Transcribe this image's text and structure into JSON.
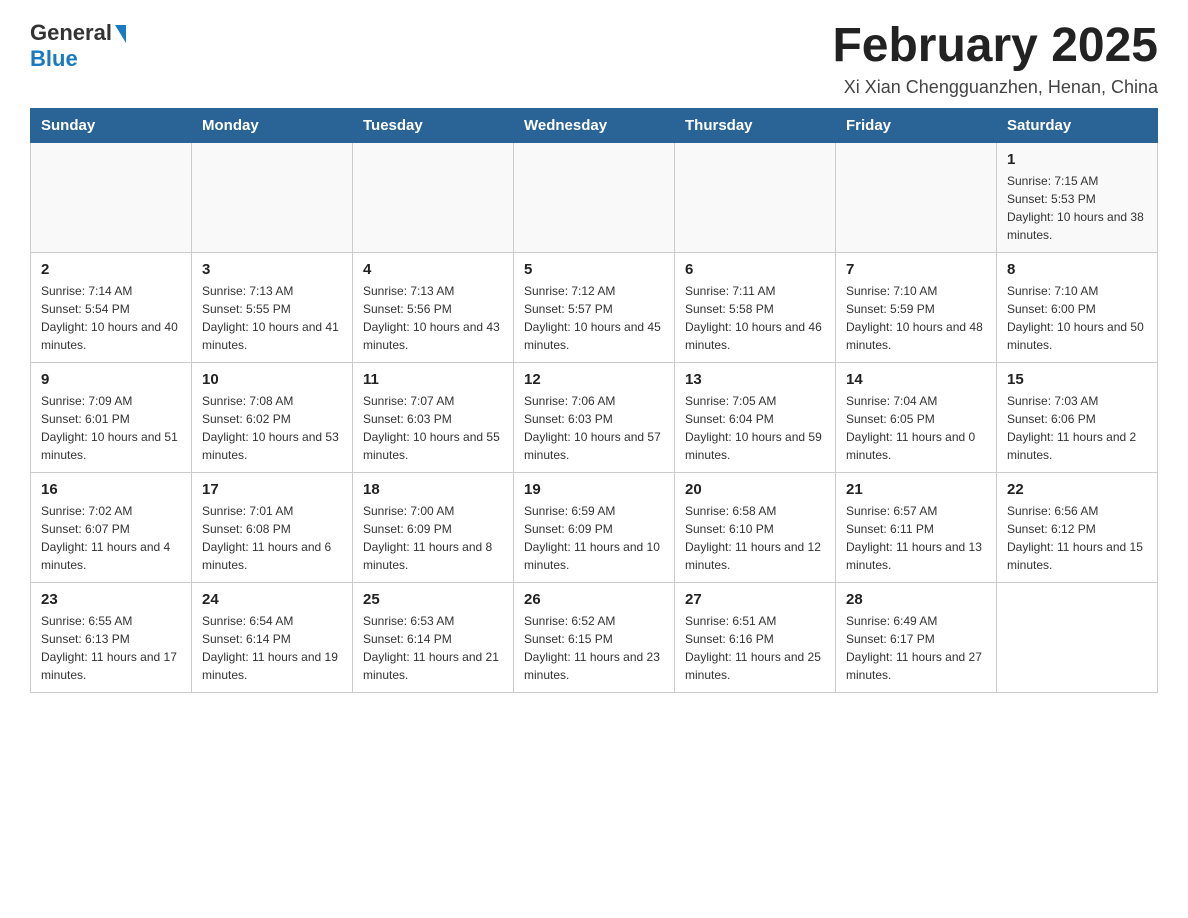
{
  "header": {
    "logo_general": "General",
    "logo_blue": "Blue",
    "month_title": "February 2025",
    "location": "Xi Xian Chengguanzhen, Henan, China"
  },
  "days_of_week": [
    "Sunday",
    "Monday",
    "Tuesday",
    "Wednesday",
    "Thursday",
    "Friday",
    "Saturday"
  ],
  "weeks": [
    {
      "days": [
        {
          "number": "",
          "info": ""
        },
        {
          "number": "",
          "info": ""
        },
        {
          "number": "",
          "info": ""
        },
        {
          "number": "",
          "info": ""
        },
        {
          "number": "",
          "info": ""
        },
        {
          "number": "",
          "info": ""
        },
        {
          "number": "1",
          "info": "Sunrise: 7:15 AM\nSunset: 5:53 PM\nDaylight: 10 hours and 38 minutes."
        }
      ]
    },
    {
      "days": [
        {
          "number": "2",
          "info": "Sunrise: 7:14 AM\nSunset: 5:54 PM\nDaylight: 10 hours and 40 minutes."
        },
        {
          "number": "3",
          "info": "Sunrise: 7:13 AM\nSunset: 5:55 PM\nDaylight: 10 hours and 41 minutes."
        },
        {
          "number": "4",
          "info": "Sunrise: 7:13 AM\nSunset: 5:56 PM\nDaylight: 10 hours and 43 minutes."
        },
        {
          "number": "5",
          "info": "Sunrise: 7:12 AM\nSunset: 5:57 PM\nDaylight: 10 hours and 45 minutes."
        },
        {
          "number": "6",
          "info": "Sunrise: 7:11 AM\nSunset: 5:58 PM\nDaylight: 10 hours and 46 minutes."
        },
        {
          "number": "7",
          "info": "Sunrise: 7:10 AM\nSunset: 5:59 PM\nDaylight: 10 hours and 48 minutes."
        },
        {
          "number": "8",
          "info": "Sunrise: 7:10 AM\nSunset: 6:00 PM\nDaylight: 10 hours and 50 minutes."
        }
      ]
    },
    {
      "days": [
        {
          "number": "9",
          "info": "Sunrise: 7:09 AM\nSunset: 6:01 PM\nDaylight: 10 hours and 51 minutes."
        },
        {
          "number": "10",
          "info": "Sunrise: 7:08 AM\nSunset: 6:02 PM\nDaylight: 10 hours and 53 minutes."
        },
        {
          "number": "11",
          "info": "Sunrise: 7:07 AM\nSunset: 6:03 PM\nDaylight: 10 hours and 55 minutes."
        },
        {
          "number": "12",
          "info": "Sunrise: 7:06 AM\nSunset: 6:03 PM\nDaylight: 10 hours and 57 minutes."
        },
        {
          "number": "13",
          "info": "Sunrise: 7:05 AM\nSunset: 6:04 PM\nDaylight: 10 hours and 59 minutes."
        },
        {
          "number": "14",
          "info": "Sunrise: 7:04 AM\nSunset: 6:05 PM\nDaylight: 11 hours and 0 minutes."
        },
        {
          "number": "15",
          "info": "Sunrise: 7:03 AM\nSunset: 6:06 PM\nDaylight: 11 hours and 2 minutes."
        }
      ]
    },
    {
      "days": [
        {
          "number": "16",
          "info": "Sunrise: 7:02 AM\nSunset: 6:07 PM\nDaylight: 11 hours and 4 minutes."
        },
        {
          "number": "17",
          "info": "Sunrise: 7:01 AM\nSunset: 6:08 PM\nDaylight: 11 hours and 6 minutes."
        },
        {
          "number": "18",
          "info": "Sunrise: 7:00 AM\nSunset: 6:09 PM\nDaylight: 11 hours and 8 minutes."
        },
        {
          "number": "19",
          "info": "Sunrise: 6:59 AM\nSunset: 6:09 PM\nDaylight: 11 hours and 10 minutes."
        },
        {
          "number": "20",
          "info": "Sunrise: 6:58 AM\nSunset: 6:10 PM\nDaylight: 11 hours and 12 minutes."
        },
        {
          "number": "21",
          "info": "Sunrise: 6:57 AM\nSunset: 6:11 PM\nDaylight: 11 hours and 13 minutes."
        },
        {
          "number": "22",
          "info": "Sunrise: 6:56 AM\nSunset: 6:12 PM\nDaylight: 11 hours and 15 minutes."
        }
      ]
    },
    {
      "days": [
        {
          "number": "23",
          "info": "Sunrise: 6:55 AM\nSunset: 6:13 PM\nDaylight: 11 hours and 17 minutes."
        },
        {
          "number": "24",
          "info": "Sunrise: 6:54 AM\nSunset: 6:14 PM\nDaylight: 11 hours and 19 minutes."
        },
        {
          "number": "25",
          "info": "Sunrise: 6:53 AM\nSunset: 6:14 PM\nDaylight: 11 hours and 21 minutes."
        },
        {
          "number": "26",
          "info": "Sunrise: 6:52 AM\nSunset: 6:15 PM\nDaylight: 11 hours and 23 minutes."
        },
        {
          "number": "27",
          "info": "Sunrise: 6:51 AM\nSunset: 6:16 PM\nDaylight: 11 hours and 25 minutes."
        },
        {
          "number": "28",
          "info": "Sunrise: 6:49 AM\nSunset: 6:17 PM\nDaylight: 11 hours and 27 minutes."
        },
        {
          "number": "",
          "info": ""
        }
      ]
    }
  ]
}
